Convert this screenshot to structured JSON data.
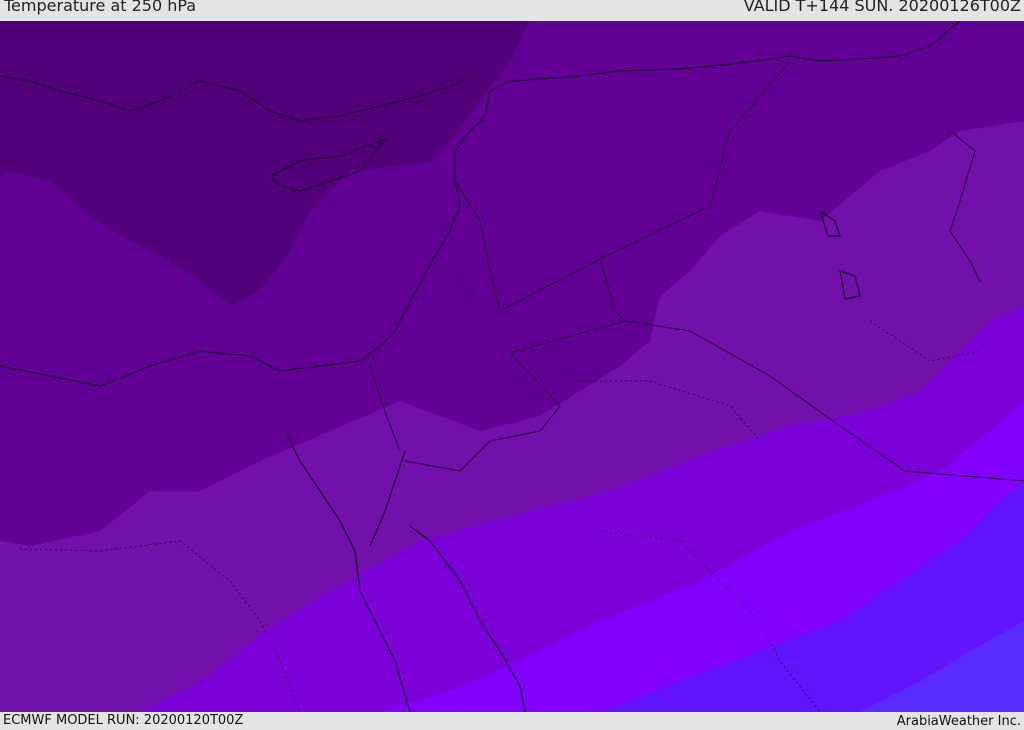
{
  "header": {
    "title": "Temperature at 250 hPa",
    "valid": "VALID T+144 SUN. 20200126T00Z"
  },
  "footer": {
    "model_run": "ECMWF MODEL RUN: 20200120T00Z",
    "credit": "ArabiaWeather Inc."
  },
  "map": {
    "field": "Temperature at 250 hPa",
    "palette": [
      "#52007a",
      "#620096",
      "#7210ac",
      "#7c00d8",
      "#8200ff",
      "#6214ff",
      "#5a2cff"
    ],
    "boundary_color": "#1a0030"
  }
}
